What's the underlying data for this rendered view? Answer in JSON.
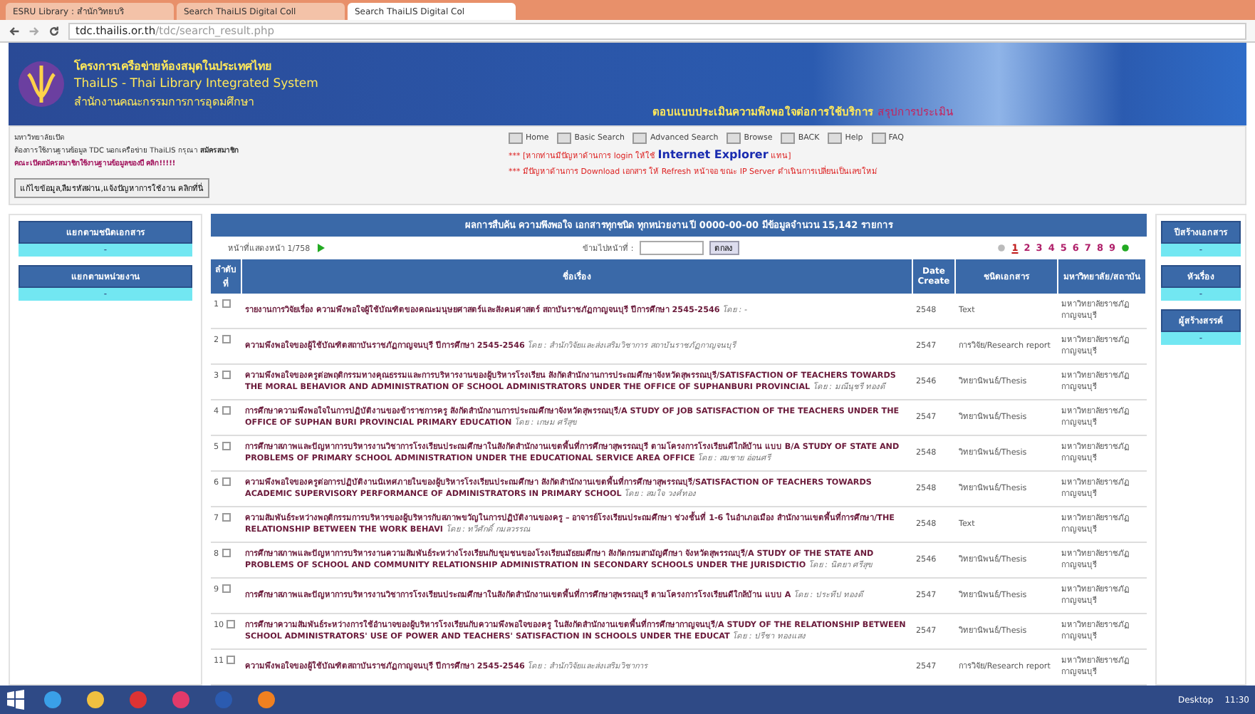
{
  "browser": {
    "tabs": [
      {
        "label": "ESRU Library : สำนักวิทยบริ",
        "selected": false
      },
      {
        "label": "Search ThaiLIS Digital Coll",
        "selected": false
      },
      {
        "label": "Search ThaiLIS Digital Col",
        "selected": true
      }
    ],
    "url_host": "tdc.thailis.or.th",
    "url_path": "/tdc/search_result.php"
  },
  "banner": {
    "title_th": "โครงการเครือข่ายห้องสมุดในประเทศไทย",
    "title_en": "ThaiLIS - Thai Library Integrated System",
    "org": "สำนักงานคณะกรรมการการอุดมศึกษา",
    "survey": "ตอบแบบประเมินความพึงพอใจต่อการใช้บริการ",
    "survey_link": "สรุปการประเมิน"
  },
  "notice": {
    "lines": [
      "มหาวิทยาลัยเปิด",
      "ต้องการใช้งานฐานข้อมูล TDC นอกเครือข่าย ThaiLIS กรุณา **สมัครสมาชิก**",
      "**คณะเปิดสมัครสมาชิกใช้งานฐานข้อมูลของปี คลิก!!!!!**"
    ],
    "button": "แก้ไขข้อมูล,ลืมรหัสผ่าน,แจ้งปัญหาการใช้งาน คลิกที่นี่"
  },
  "nav": [
    "Home",
    "Basic Search",
    "Advanced Search",
    "Browse",
    "BACK",
    "Help",
    "FAQ"
  ],
  "alerts": [
    {
      "text": "*** [หากท่านมีปัญหาด้านการ login ให้ใช้",
      "highlight": "Internet Explorer",
      "after": "แทน]"
    },
    {
      "text": "*** มีปัญหาด้านการ Download เอกสาร ให้ Refresh หน้าจอ ขณะ IP Server ดำเนินการเปลี่ยนเป็นเลขใหม่"
    }
  ],
  "left_filters": [
    {
      "title": "แยกตามชนิดเอกสาร",
      "value": "-"
    },
    {
      "title": "แยกตามหน่วยงาน",
      "value": "-"
    }
  ],
  "right_filters": [
    {
      "title": "ปีสร้างเอกสาร",
      "value": "-"
    },
    {
      "title": "หัวเรื่อง",
      "value": "-"
    },
    {
      "title": "ผู้สร้างสรรค์",
      "value": "-"
    }
  ],
  "results": {
    "heading": "ผลการสืบค้น ความพึงพอใจ เอกสารทุกชนิด ทุกหน่วยงาน ปี 0000-00-00 มีข้อมูลจำนวน 15,142 รายการ",
    "page_info": "หน้าที่แสดงหน้า 1/758",
    "jump_label": "ข้ามไปหน้าที่ :",
    "jump_button": "ตกลง",
    "pages": [
      {
        "label": "1",
        "selected": true
      },
      {
        "label": "2",
        "selected": false
      },
      {
        "label": "3",
        "selected": false
      },
      {
        "label": "4",
        "selected": false
      },
      {
        "label": "5",
        "selected": false
      },
      {
        "label": "6",
        "selected": false
      },
      {
        "label": "7",
        "selected": false
      },
      {
        "label": "8",
        "selected": false
      },
      {
        "label": "9",
        "selected": false
      }
    ],
    "columns": [
      "ลำดับที่",
      "ชื่อเรื่อง",
      "Date Create",
      "ชนิดเอกสาร",
      "มหาวิทยาลัย/สถาบัน"
    ],
    "rows": [
      {
        "no": "1",
        "checked": false,
        "title": "รายงานการวิจัยเรื่อง ความพึงพอใจผู้ใช้บัณฑิตของคณะมนุษยศาสตร์และสังคมศาสตร์ สถาบันราชภัฏกาญจนบุรี ปีการศึกษา 2545-2546",
        "author": "โดย : -",
        "year": "2548",
        "type": "Text",
        "institution": "มหาวิทยาลัยราชภัฏกาญจนบุรี"
      },
      {
        "no": "2",
        "checked": false,
        "title": "ความพึงพอใจของผู้ใช้บัณฑิตสถาบันราชภัฏกาญจนบุรี ปีการศึกษา 2545-2546",
        "author": "โดย : สำนักวิจัยและส่งเสริมวิชาการ สถาบันราชภัฏกาญจนบุรี",
        "year": "2547",
        "type": "การวิจัย/Research report",
        "institution": "มหาวิทยาลัยราชภัฏกาญจนบุรี"
      },
      {
        "no": "3",
        "checked": false,
        "title": "ความพึงพอใจของครูต่อพฤติกรรมทางคุณธรรมและการบริหารงานของผู้บริหารโรงเรียน สังกัดสำนักงานการประถมศึกษาจังหวัดสุพรรณบุรี/SATISFACTION OF TEACHERS TOWARDS THE MORAL BEHAVIOR AND ADMINISTRATION OF SCHOOL ADMINISTRATORS UNDER THE OFFICE OF SUPHANBURI PROVINCIAL",
        "author": "โดย : มณีนุชรี ทองดี",
        "year": "2546",
        "type": "วิทยานิพนธ์/Thesis",
        "institution": "มหาวิทยาลัยราชภัฏกาญจนบุรี"
      },
      {
        "no": "4",
        "checked": false,
        "title": "การศึกษาความพึงพอใจในการปฏิบัติงานของข้าราชการครู สังกัดสำนักงานการประถมศึกษาจังหวัดสุพรรณบุรี/A STUDY OF JOB SATISFACTION OF THE TEACHERS UNDER THE OFFICE OF SUPHAN BURI PROVINCIAL PRIMARY EDUCATION",
        "author": "โดย : เกษม ศรีสุข",
        "year": "2547",
        "type": "วิทยานิพนธ์/Thesis",
        "institution": "มหาวิทยาลัยราชภัฏกาญจนบุรี"
      },
      {
        "no": "5",
        "checked": false,
        "title": "การศึกษาสภาพและปัญหาการบริหารงานวิชาการโรงเรียนประถมศึกษาในสังกัดสำนักงานเขตพื้นที่การศึกษาสุพรรณบุรี ตามโครงการโรงเรียนดีใกล้บ้าน แบบ B/A STUDY OF STATE AND PROBLEMS OF PRIMARY SCHOOL ADMINISTRATION UNDER THE EDUCATIONAL SERVICE AREA OFFICE",
        "author": "โดย : สมชาย อ่อนศรี",
        "year": "2548",
        "type": "วิทยานิพนธ์/Thesis",
        "institution": "มหาวิทยาลัยราชภัฏกาญจนบุรี"
      },
      {
        "no": "6",
        "checked": false,
        "title": "ความพึงพอใจของครูต่อการปฏิบัติงานนิเทศภายในของผู้บริหารโรงเรียนประถมศึกษา สังกัดสำนักงานเขตพื้นที่การศึกษาสุพรรณบุรี/SATISFACTION OF TEACHERS TOWARDS ACADEMIC SUPERVISORY PERFORMANCE OF ADMINISTRATORS IN PRIMARY SCHOOL",
        "author": "โดย : สมใจ วงศ์ทอง",
        "year": "2548",
        "type": "วิทยานิพนธ์/Thesis",
        "institution": "มหาวิทยาลัยราชภัฏกาญจนบุรี"
      },
      {
        "no": "7",
        "checked": false,
        "title": "ความสัมพันธ์ระหว่างพฤติกรรมการบริหารของผู้บริหารกับสภาพขวัญในการปฏิบัติงานของครู – อาจารย์โรงเรียนประถมศึกษา ช่วงชั้นที่ 1-6 ในอำเภอเมือง สำนักงานเขตพื้นที่การศึกษา/THE RELATIONSHIP BETWEEN THE WORK BEHAVI",
        "author": "โดย : ทวีศักดิ์ กมลวรรณ",
        "year": "2548",
        "type": "Text",
        "institution": "มหาวิทยาลัยราชภัฏกาญจนบุรี"
      },
      {
        "no": "8",
        "checked": false,
        "title": "การศึกษาสภาพและปัญหาการบริหารงานความสัมพันธ์ระหว่างโรงเรียนกับชุมชนของโรงเรียนมัธยมศึกษา สังกัดกรมสามัญศึกษา จังหวัดสุพรรณบุรี/A STUDY OF THE STATE AND PROBLEMS OF SCHOOL AND COMMUNITY RELATIONSHIP ADMINISTRATION IN SECONDARY SCHOOLS UNDER THE JURISDICTIO",
        "author": "โดย : นิตยา ศรีสุข",
        "year": "2546",
        "type": "วิทยานิพนธ์/Thesis",
        "institution": "มหาวิทยาลัยราชภัฏกาญจนบุรี"
      },
      {
        "no": "9",
        "checked": false,
        "title": "การศึกษาสภาพและปัญหาการบริหารงานวิชาการโรงเรียนประถมศึกษาในสังกัดสำนักงานเขตพื้นที่การศึกษาสุพรรณบุรี ตามโครงการโรงเรียนดีใกล้บ้าน แบบ A",
        "author": "โดย : ประทีป ทองดี",
        "year": "2547",
        "type": "วิทยานิพนธ์/Thesis",
        "institution": "มหาวิทยาลัยราชภัฏกาญจนบุรี"
      },
      {
        "no": "10",
        "checked": false,
        "title": "การศึกษาความสัมพันธ์ระหว่างการใช้อำนาจของผู้บริหารโรงเรียนกับความพึงพอใจของครู ในสังกัดสำนักงานเขตพื้นที่การศึกษากาญจนบุรี/A STUDY OF THE RELATIONSHIP BETWEEN SCHOOL ADMINISTRATORS' USE OF POWER AND TEACHERS' SATISFACTION IN SCHOOLS UNDER THE EDUCAT",
        "author": "โดย : ปรีชา ทองแสง",
        "year": "2547",
        "type": "วิทยานิพนธ์/Thesis",
        "institution": "มหาวิทยาลัยราชภัฏกาญจนบุรี"
      },
      {
        "no": "11",
        "checked": false,
        "title": "ความพึงพอใจของผู้ใช้บัณฑิตสถาบันราชภัฏกาญจนบุรี ปีการศึกษา 2545-2546",
        "author": "โดย : สำนักวิจัยและส่งเสริมวิชาการ",
        "year": "2547",
        "type": "การวิจัย/Research report",
        "institution": "มหาวิทยาลัยราชภัฏกาญจนบุรี"
      }
    ]
  },
  "taskbar": {
    "desktop": "Desktop",
    "time": "11:30"
  }
}
